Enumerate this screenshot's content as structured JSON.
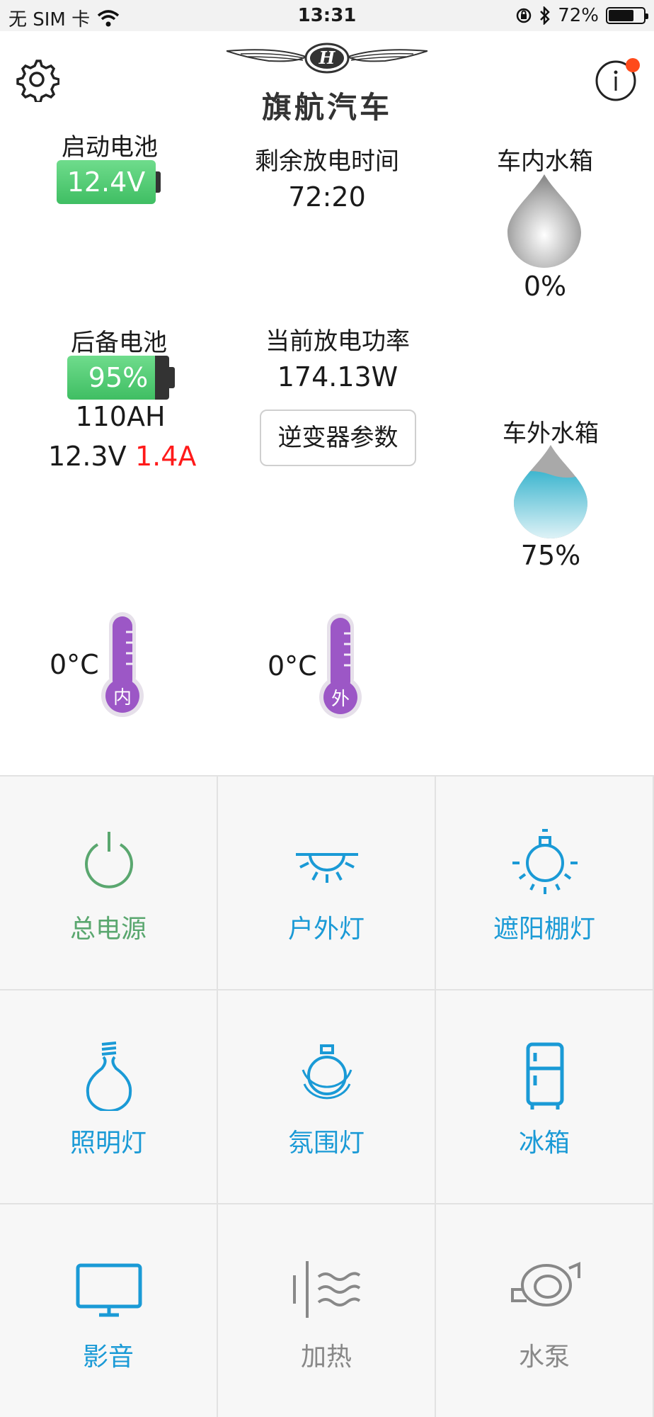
{
  "status_bar": {
    "carrier": "无 SIM 卡",
    "time": "13:31",
    "battery_percent": "72%",
    "battery_level": 0.72
  },
  "header": {
    "brand": "旗航汽车",
    "settings_icon": "gear-icon",
    "info_icon": "info-icon"
  },
  "start_battery": {
    "label": "启动电池",
    "voltage": "12.4V"
  },
  "discharge_time": {
    "label": "剩余放电时间",
    "value": "72:20"
  },
  "inner_tank": {
    "label": "车内水箱",
    "percent": "0%",
    "level": 0
  },
  "backup_battery": {
    "label": "后备电池",
    "percent": "95%",
    "level": 0.95,
    "capacity": "110AH",
    "voltage": "12.3V",
    "current": "1.4A"
  },
  "discharge_power": {
    "label": "当前放电功率",
    "value": "174.13W",
    "inverter_button": "逆变器参数"
  },
  "outer_tank": {
    "label": "车外水箱",
    "percent": "75%",
    "level": 0.75
  },
  "temp_inside": {
    "value": "0°C",
    "tag": "内"
  },
  "temp_outside": {
    "value": "0°C",
    "tag": "外"
  },
  "controls": [
    {
      "label": "总电源",
      "icon": "power-icon",
      "color": "#5aa76f"
    },
    {
      "label": "户外灯",
      "icon": "outdoor-light-icon",
      "color": "#1a9ad6"
    },
    {
      "label": "遮阳棚灯",
      "icon": "awning-light-icon",
      "color": "#1a9ad6"
    },
    {
      "label": "照明灯",
      "icon": "bulb-icon",
      "color": "#1a9ad6"
    },
    {
      "label": "氛围灯",
      "icon": "ambient-light-icon",
      "color": "#1a9ad6"
    },
    {
      "label": "冰箱",
      "icon": "fridge-icon",
      "color": "#1a9ad6"
    },
    {
      "label": "影音",
      "icon": "tv-icon",
      "color": "#1a9ad6"
    },
    {
      "label": "加热",
      "icon": "heater-icon",
      "color": "#888888"
    },
    {
      "label": "水泵",
      "icon": "pump-icon",
      "color": "#888888"
    }
  ]
}
